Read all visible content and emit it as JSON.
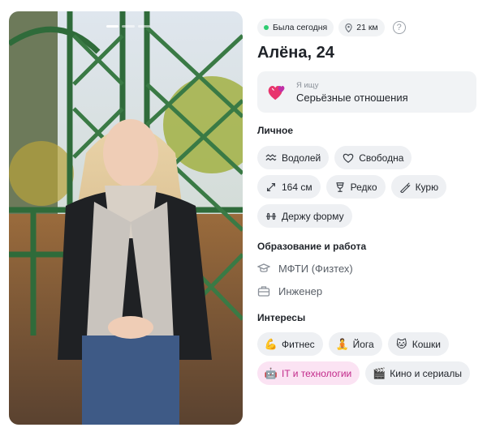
{
  "profile": {
    "status": "Была сегодня",
    "distance": "21 км",
    "help": "?",
    "name_age": "Алёна, 24"
  },
  "goal": {
    "label": "Я ищу",
    "value": "Серьёзные отношения"
  },
  "personal": {
    "title": "Личное",
    "chips": [
      {
        "label": "Водолей",
        "icon": "aquarius-icon"
      },
      {
        "label": "Свободна",
        "icon": "heart-outline-icon"
      },
      {
        "label": "164 см",
        "icon": "height-arrows-icon"
      },
      {
        "label": "Редко",
        "icon": "wine-glass-icon"
      },
      {
        "label": "Курю",
        "icon": "cigarette-icon"
      },
      {
        "label": "Держу форму",
        "icon": "dumbbell-icon"
      }
    ]
  },
  "education": {
    "title": "Образование и работа",
    "items": [
      {
        "label": "МФТИ (Физтех)",
        "icon": "graduation-cap-icon"
      },
      {
        "label": "Инженер",
        "icon": "briefcase-icon"
      }
    ]
  },
  "interests": {
    "title": "Интересы",
    "chips": [
      {
        "label": "Фитнес",
        "emoji": "💪",
        "icon": "flexed-biceps-icon"
      },
      {
        "label": "Йога",
        "emoji": "🧘",
        "icon": "yoga-icon"
      },
      {
        "label": "Кошки",
        "emoji": "🐱",
        "icon": "cat-icon"
      },
      {
        "label": "IT и технологии",
        "emoji": "🤖",
        "icon": "robot-icon",
        "highlighted": true
      },
      {
        "label": "Кино и сериалы",
        "emoji": "🎬",
        "icon": "clapper-icon"
      }
    ]
  },
  "colors": {
    "online": "#2ecc71",
    "chip_bg": "#eef0f3",
    "highlight_bg": "#fbe3f3",
    "highlight_text": "#c2298a"
  }
}
